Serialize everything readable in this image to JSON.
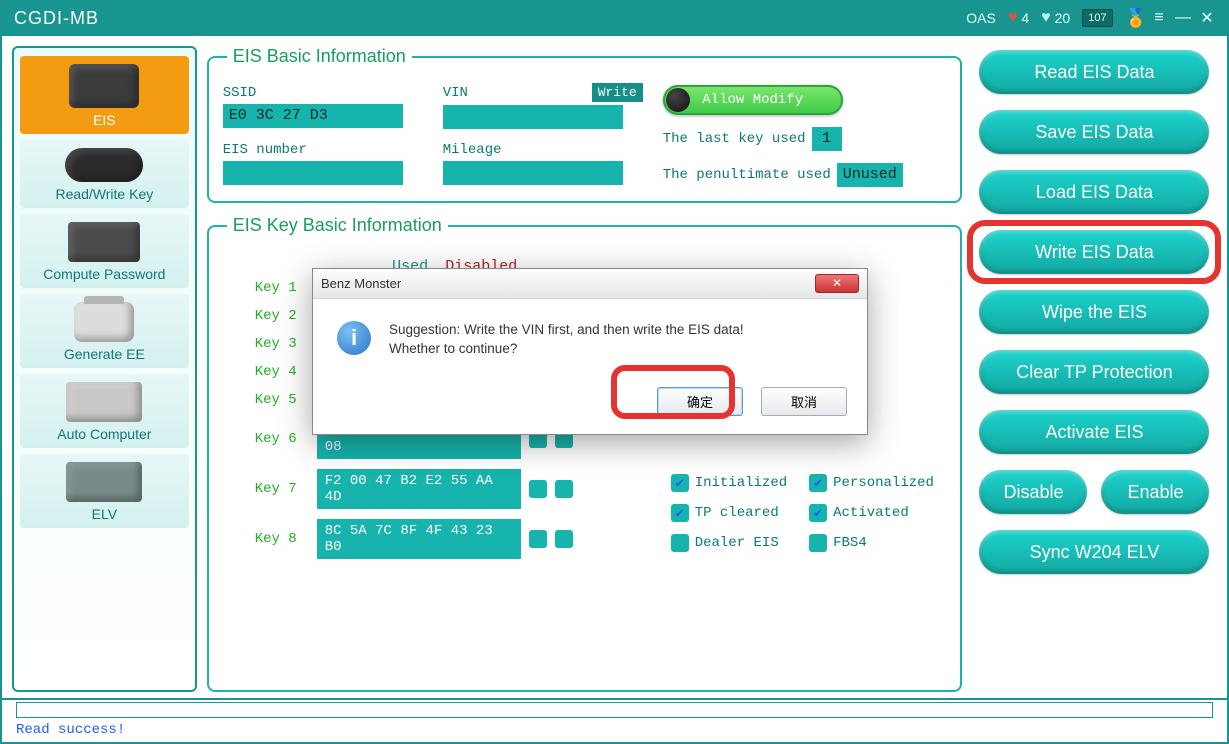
{
  "titlebar": {
    "title": "CGDI-MB",
    "oas_label": "OAS",
    "hearts_red": "4",
    "hearts_teal": "20",
    "box_value": "107"
  },
  "sidebar": {
    "items": [
      {
        "label": "EIS"
      },
      {
        "label": "Read/Write Key"
      },
      {
        "label": "Compute Password"
      },
      {
        "label": "Generate EE"
      },
      {
        "label": "Auto Computer"
      },
      {
        "label": "ELV"
      }
    ]
  },
  "eis_basic": {
    "legend": "EIS Basic Information",
    "ssid_label": "SSID",
    "ssid_value": "E0 3C 27 D3",
    "vin_label": "VIN",
    "vin_value": "",
    "write_btn": "Write",
    "eis_number_label": "EIS number",
    "eis_number_value": "",
    "mileage_label": "Mileage",
    "mileage_value": "",
    "allow_modify": "Allow Modify",
    "last_key_label": "The last key used",
    "last_key_value": "1",
    "penult_label": "The penultimate used",
    "penult_value": "Unused"
  },
  "eis_keys": {
    "legend": "EIS Key Basic Information",
    "header_used": "Used",
    "header_disabled": "Disabled",
    "rows": [
      {
        "label": "Key 1",
        "value": ""
      },
      {
        "label": "Key 2",
        "value": ""
      },
      {
        "label": "Key 3",
        "value": ""
      },
      {
        "label": "Key 4",
        "value": ""
      },
      {
        "label": "Key 5",
        "value": ""
      },
      {
        "label": "Key 6",
        "value": "44 CD 93 EC 66 43 F8 08"
      },
      {
        "label": "Key 7",
        "value": "F2 00 47 B2 E2 55 AA 4D"
      },
      {
        "label": "Key 8",
        "value": "8C 5A 7C 8F 4F 43 23 B0"
      }
    ],
    "flags": {
      "initialized": {
        "label": "Initialized",
        "checked": true
      },
      "personalized": {
        "label": "Personalized",
        "checked": true
      },
      "tp_cleared": {
        "label": "TP cleared",
        "checked": true
      },
      "activated": {
        "label": "Activated",
        "checked": true
      },
      "dealer_eis": {
        "label": "Dealer EIS",
        "checked": false
      },
      "fbs4": {
        "label": "FBS4",
        "checked": false
      }
    }
  },
  "actions": {
    "read": "Read  EIS Data",
    "save": "Save EIS Data",
    "load": "Load EIS Data",
    "write": "Write EIS Data",
    "wipe": "Wipe the EIS",
    "clear_tp": "Clear TP Protection",
    "activate": "Activate EIS",
    "disable": "Disable",
    "enable": "Enable",
    "sync": "Sync W204 ELV"
  },
  "dialog": {
    "title": "Benz Monster",
    "msg_line1": "Suggestion: Write the VIN first, and then write the EIS data!",
    "msg_line2": "Whether to continue?",
    "ok": "确定",
    "cancel": "取消"
  },
  "status": "Read success!"
}
